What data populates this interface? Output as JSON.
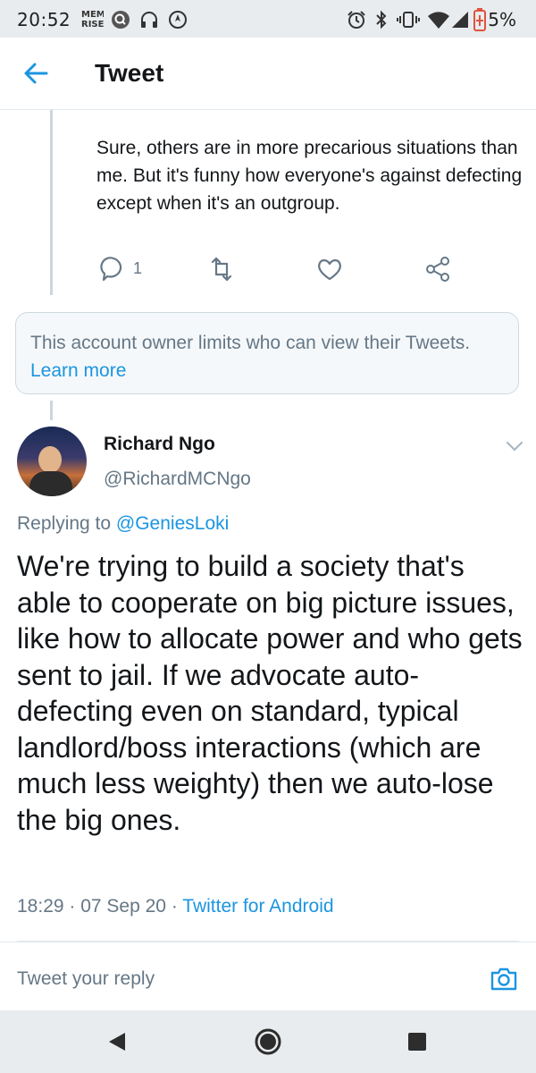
{
  "status_bar": {
    "time": "20:52",
    "battery": "5%",
    "icons": [
      "mem-rise-icon",
      "search-app-icon",
      "headphones-icon",
      "location-icon",
      "alarm-icon",
      "bluetooth-icon",
      "vibrate-icon",
      "wifi-icon",
      "signal-icon",
      "battery-icon"
    ]
  },
  "app_bar": {
    "back_icon": "arrow-left-icon",
    "title": "Tweet"
  },
  "previous_tweet": {
    "text": "Sure, others are in more precarious situations than me. But it's funny how everyone's against defecting except when it's an outgroup.",
    "reply_count": "1",
    "actions": [
      "reply-icon",
      "retweet-icon",
      "like-icon",
      "share-icon"
    ]
  },
  "notice": {
    "text": "This account owner limits who can view their Tweets.",
    "link": "Learn more"
  },
  "tweet": {
    "author_name": "Richard Ngo",
    "author_handle": "@RichardMCNgo",
    "replying_prefix": "Replying to",
    "replying_to": "@GeniesLoki",
    "text": "We're trying to build a society that's able to cooperate on big picture issues, like how to allocate power and who gets sent to jail. If we advocate auto-defecting even on standard, typical landlord/boss interactions (which are much less weighty) then we auto-lose the big ones.",
    "time": "18:29",
    "date": "07 Sep 20",
    "source": "Twitter for Android"
  },
  "reply_box": {
    "placeholder": "Tweet your reply",
    "camera_icon": "camera-icon"
  },
  "nav_bar": {
    "icons": [
      "back-triangle-icon",
      "home-circle-icon",
      "recents-square-icon"
    ]
  },
  "colors": {
    "accent": "#1b95e0",
    "secondary_text": "#657786",
    "primary_text": "#14171a",
    "system_bar": "#e9ecee"
  }
}
